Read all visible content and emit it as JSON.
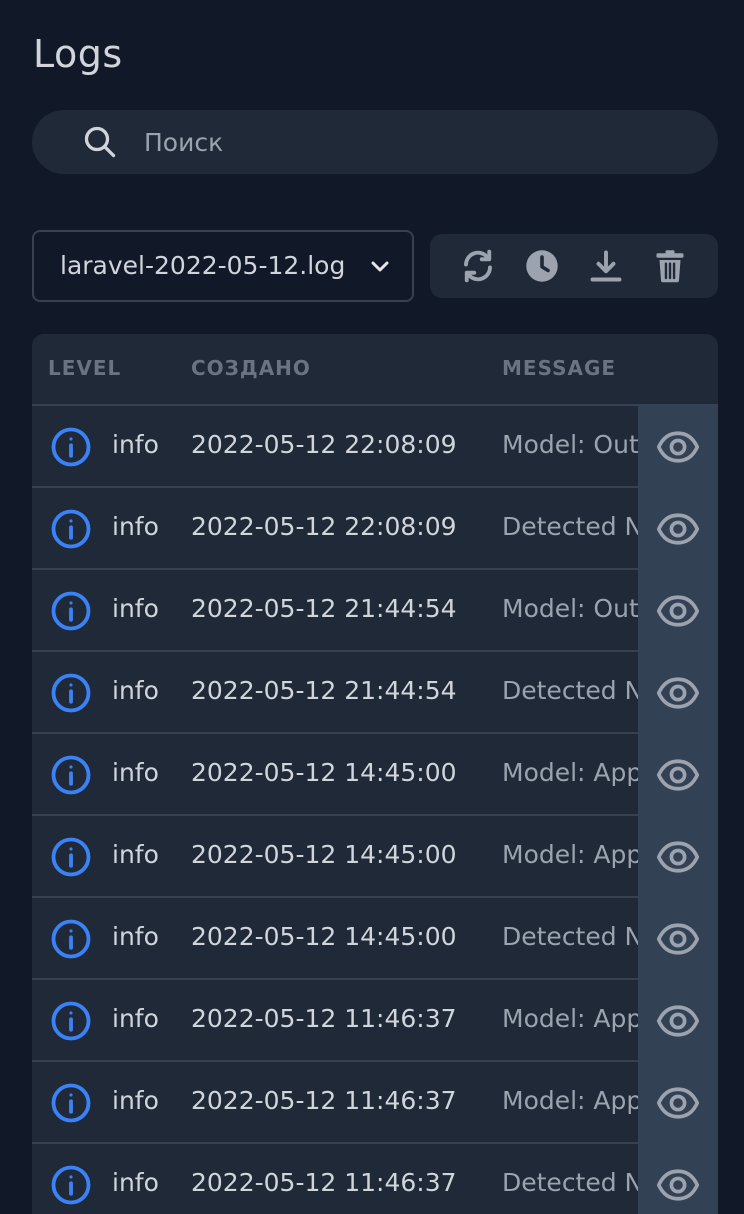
{
  "page": {
    "title": "Logs"
  },
  "search": {
    "placeholder": "Поиск",
    "icon": "search-icon"
  },
  "file_select": {
    "value": "laravel-2022-05-12.log",
    "icon": "chevron-down-icon"
  },
  "toolbar": {
    "buttons": [
      {
        "name": "refresh",
        "icon": "refresh-icon"
      },
      {
        "name": "history",
        "icon": "clock-icon"
      },
      {
        "name": "download",
        "icon": "download-icon"
      },
      {
        "name": "delete",
        "icon": "trash-icon"
      }
    ]
  },
  "table": {
    "columns": [
      "LEVEL",
      "СОЗДАНО",
      "MESSAGE"
    ],
    "rows": [
      {
        "level": "info",
        "created": "2022-05-12 22:08:09",
        "message": "Model: Out"
      },
      {
        "level": "info",
        "created": "2022-05-12 22:08:09",
        "message": "Detected N"
      },
      {
        "level": "info",
        "created": "2022-05-12 21:44:54",
        "message": "Model: Out"
      },
      {
        "level": "info",
        "created": "2022-05-12 21:44:54",
        "message": "Detected N"
      },
      {
        "level": "info",
        "created": "2022-05-12 14:45:00",
        "message": "Model: App"
      },
      {
        "level": "info",
        "created": "2022-05-12 14:45:00",
        "message": "Model: App"
      },
      {
        "level": "info",
        "created": "2022-05-12 14:45:00",
        "message": "Detected N"
      },
      {
        "level": "info",
        "created": "2022-05-12 11:46:37",
        "message": "Model: App"
      },
      {
        "level": "info",
        "created": "2022-05-12 11:46:37",
        "message": "Model: App"
      },
      {
        "level": "info",
        "created": "2022-05-12 11:46:37",
        "message": "Detected N"
      }
    ]
  },
  "colors": {
    "background": "#111827",
    "panel": "#1f2937",
    "info_accent": "#3b82f6",
    "action_cell": "#334155"
  }
}
